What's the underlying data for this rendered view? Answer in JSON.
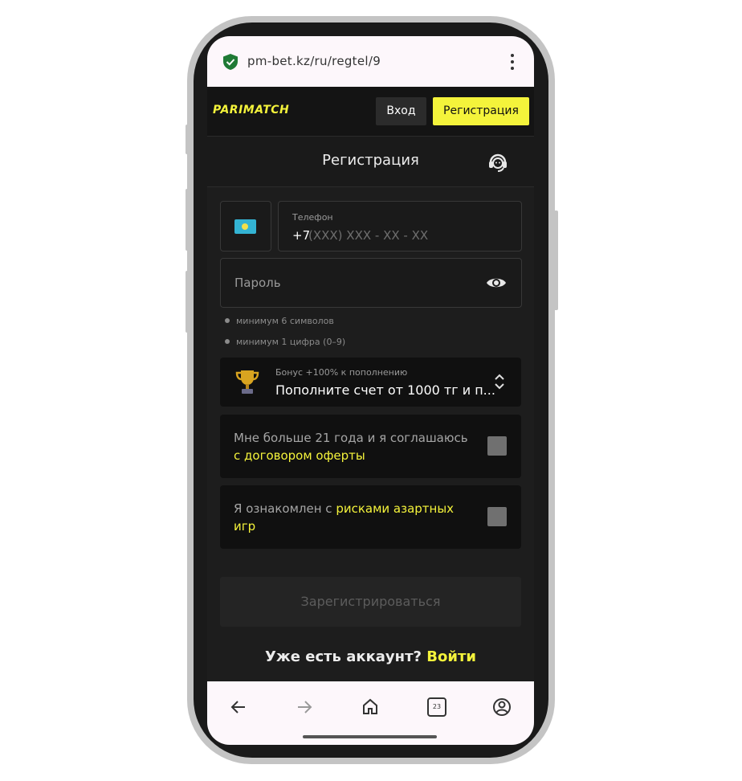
{
  "browser": {
    "url": "pm-bet.kz/ru/regtel/9",
    "tab_count": "23"
  },
  "header": {
    "logo": "PARIMATCH",
    "login_label": "Вход",
    "register_label": "Регистрация"
  },
  "page": {
    "title": "Регистрация"
  },
  "form": {
    "phone_label": "Телефон",
    "phone_prefix": "+7",
    "phone_placeholder": "(XXX) XXX - XX - XX",
    "password_placeholder": "Пароль",
    "rules": [
      "минимум 6 символов",
      "минимум 1 цифра (0–9)"
    ],
    "bonus_label": "Бонус +100% к пополнению",
    "bonus_value": "Пополните счет от 1000 тг и п...",
    "consent_age_text": "Мне больше 21 года и я соглашаюсь ",
    "consent_age_link": "с договором оферты",
    "consent_risk_text": "Я ознакомлен с ",
    "consent_risk_link": "рисками азартных игр",
    "submit_label": "Зарегистрироваться",
    "have_account_text": "Уже есть аккаунт? ",
    "have_account_link": "Войти"
  },
  "colors": {
    "accent": "#f4f33b",
    "background": "#1d1d1d",
    "field_border": "#383838"
  },
  "icons": [
    "shield-icon",
    "more-vert-icon",
    "support-icon",
    "eye-icon",
    "trophy-icon",
    "chevron-updown-icon",
    "back-icon",
    "forward-icon",
    "home-icon",
    "tabs-icon",
    "account-icon"
  ]
}
